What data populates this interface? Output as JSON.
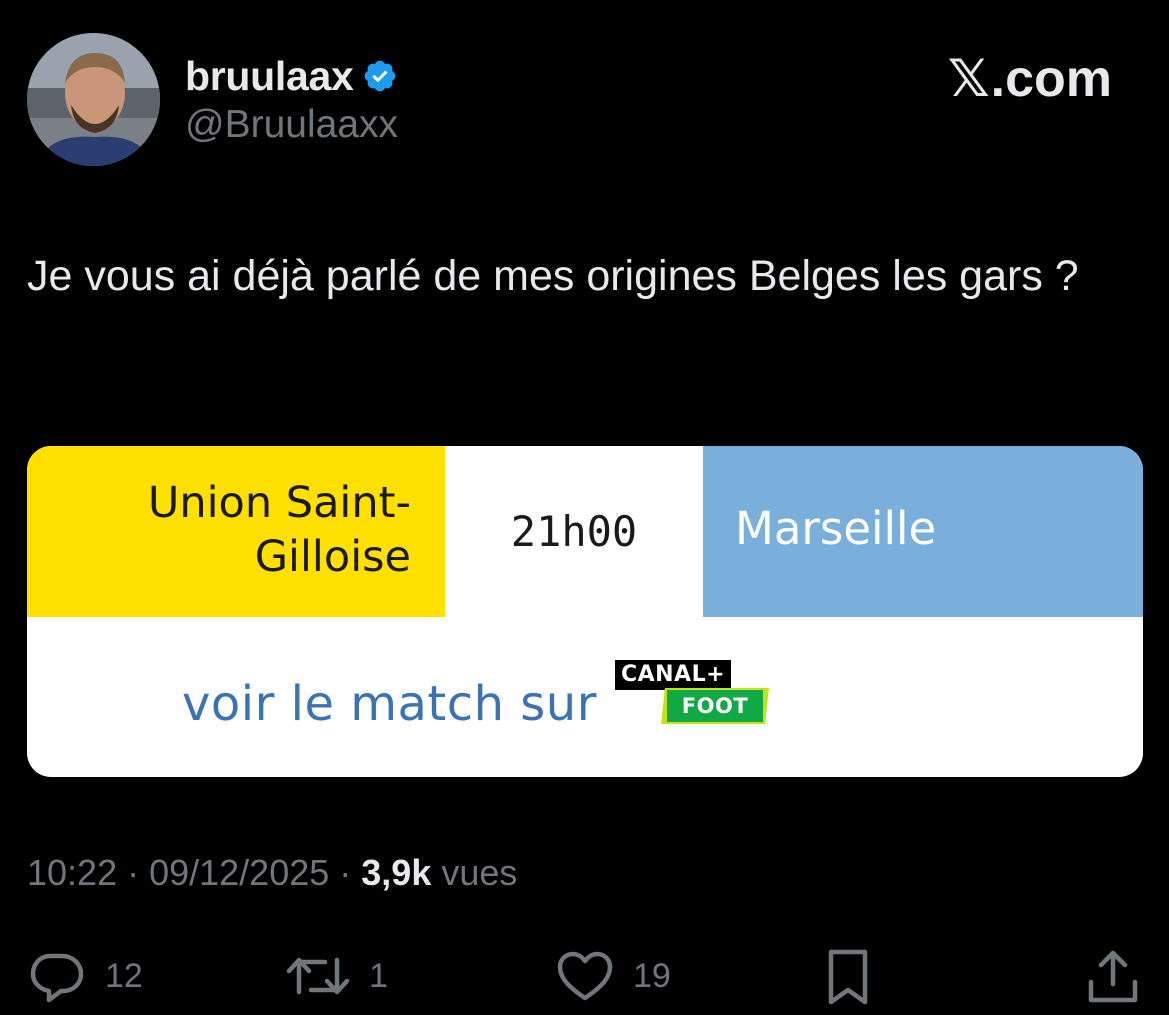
{
  "author": {
    "display_name": "bruulaax",
    "handle": "@Bruulaaxx",
    "verified": true,
    "avatar": "profile-photo"
  },
  "brand": {
    "label": ".com",
    "glyph": "𝕏"
  },
  "tweet": {
    "text": "Je vous ai déjà parlé de mes origines Belges les gars ?"
  },
  "card": {
    "home_team": "Union Saint-Gilloise",
    "kickoff": "21h00",
    "away_team": "Marseille",
    "watch_label": "voir le match sur",
    "broadcaster_line1": "CANAL+",
    "broadcaster_line2": "FOOT",
    "colors": {
      "home": "#ffe000",
      "away": "#7aaedb",
      "watch_text": "#3a72b4"
    }
  },
  "meta": {
    "time": "10:22",
    "date": "09/12/2025",
    "separator": "·",
    "views_count": "3,9k",
    "views_label": "vues"
  },
  "actions": {
    "reply_count": "12",
    "repost_count": "1",
    "like_count": "19"
  },
  "colors": {
    "background": "#000000",
    "primary_text": "#e7e9ea",
    "secondary_text": "#71767b",
    "verified": "#1d9bf0"
  }
}
